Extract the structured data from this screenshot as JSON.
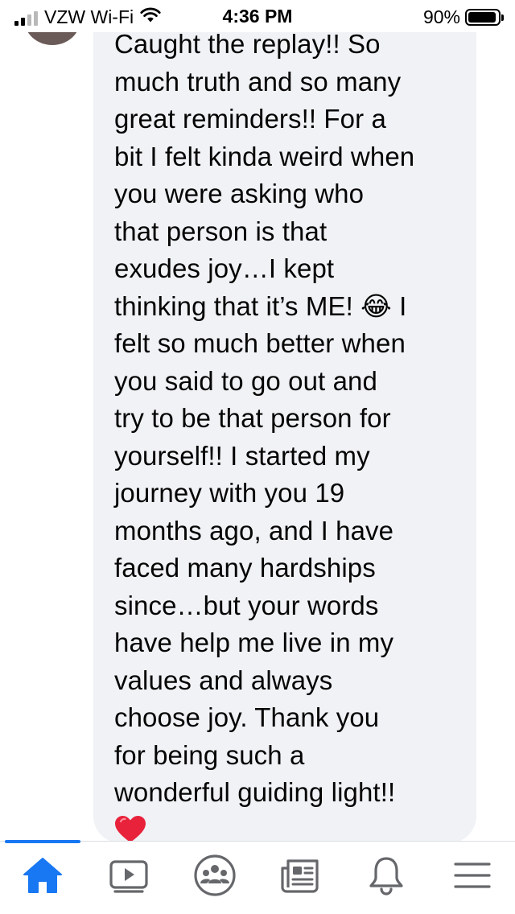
{
  "status_bar": {
    "carrier": "VZW Wi-Fi",
    "time": "4:36 PM",
    "battery": "90%"
  },
  "comment": {
    "text": "Caught the replay!! So\nmuch truth and so many\ngreat reminders!! For a\nbit I felt kinda weird when\nyou were asking who\nthat person is that\nexudes joy…I kept\nthinking that it’s ME! 😂 I\nfelt so much better when\nyou said to go out and\ntry to be that person for\nyourself!! I started my\njourney with you 19\nmonths ago, and I have\nfaced many hardships\nsince…but your words\nhave help me live in my\nvalues and always\nchoose joy. Thank you\nfor being such a\nwonderful guiding light!!",
    "reaction_icon": "red-heart-icon"
  },
  "tab_bar": {
    "accent_color": "#1877f2",
    "active_tab": "home",
    "tabs": [
      {
        "icon": "home-icon"
      },
      {
        "icon": "watch-video-icon"
      },
      {
        "icon": "groups-icon"
      },
      {
        "icon": "news-feed-icon"
      },
      {
        "icon": "notifications-bell-icon"
      },
      {
        "icon": "menu-icon"
      }
    ]
  }
}
